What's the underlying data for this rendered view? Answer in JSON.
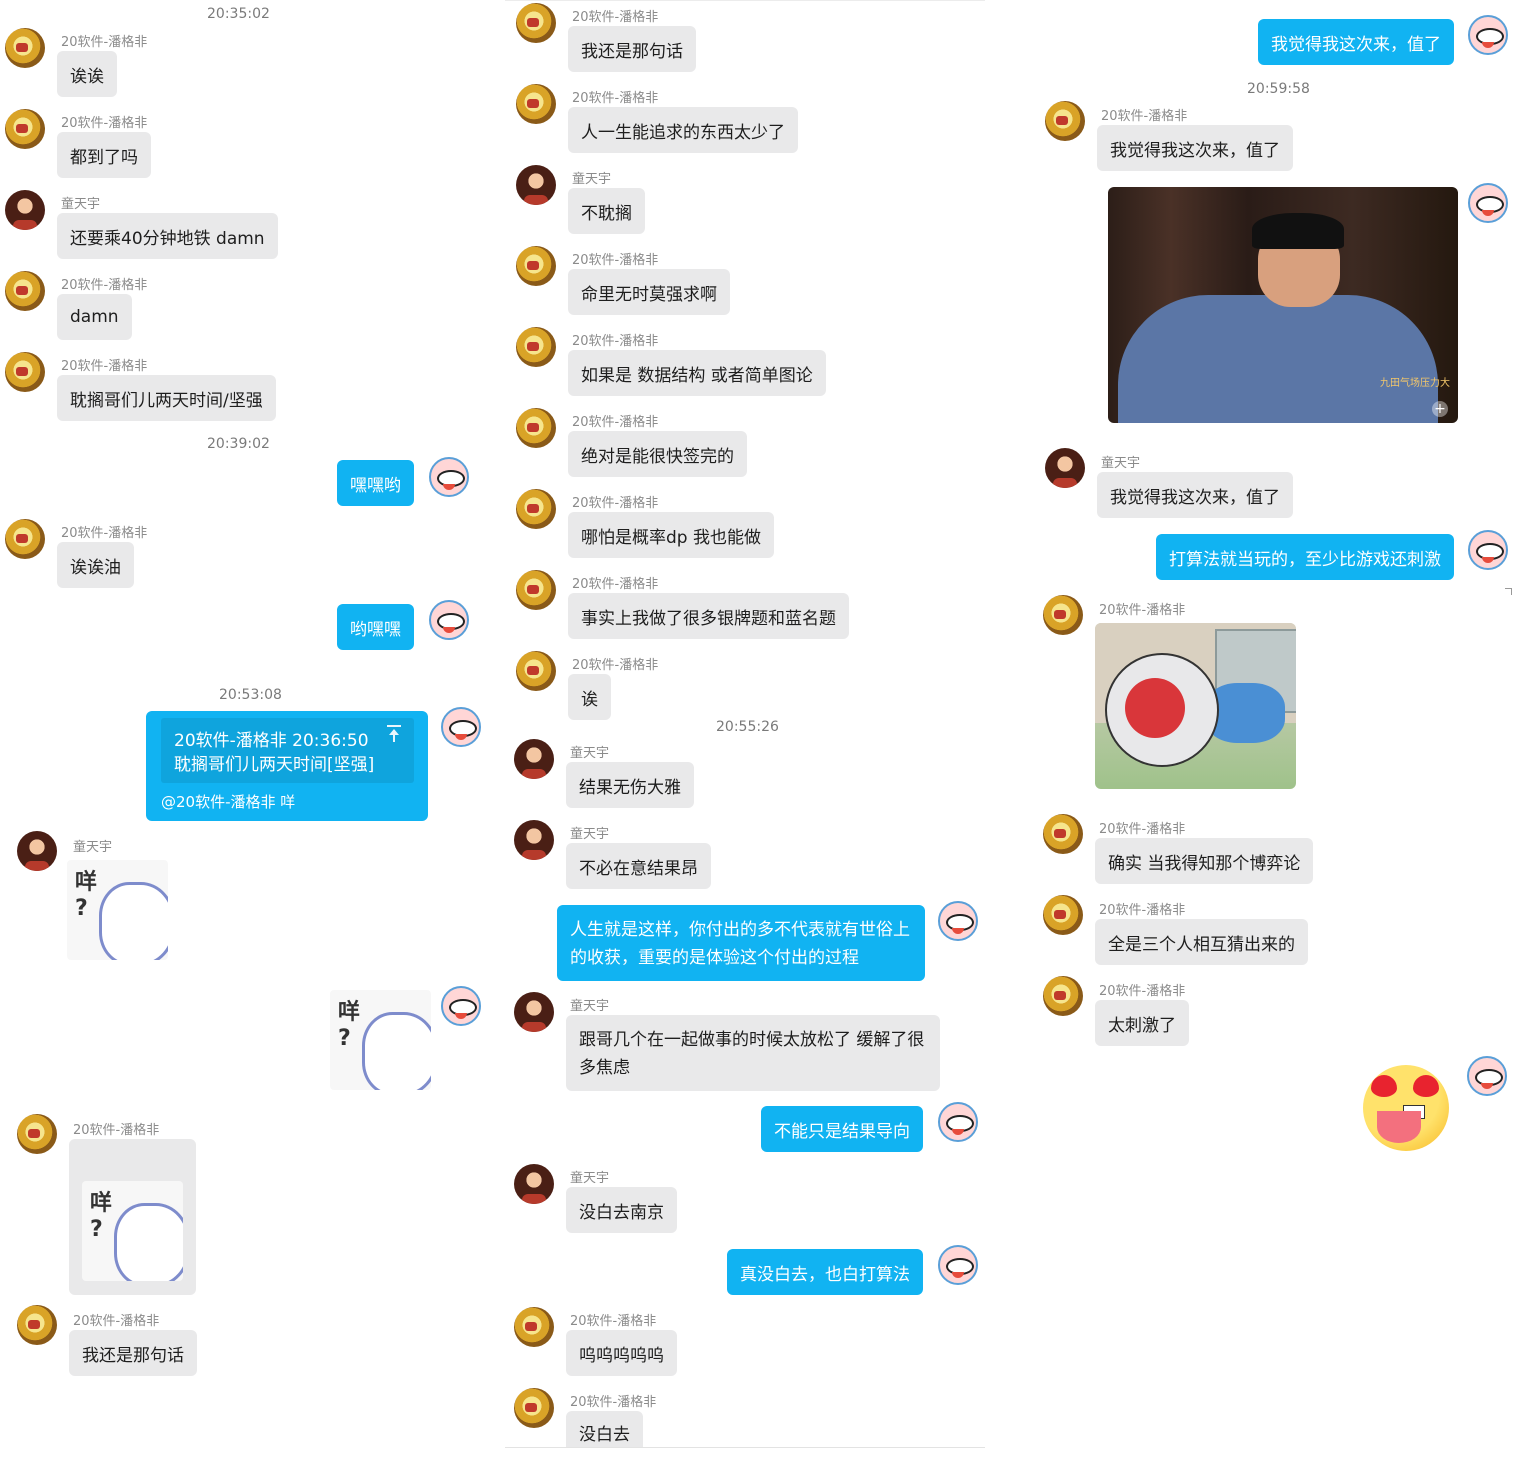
{
  "col1": {
    "ts1": "20:35:02",
    "m1": {
      "name": "20软件-潘格非",
      "text": "诶诶"
    },
    "m2": {
      "name": "20软件-潘格非",
      "text": "都到了吗"
    },
    "m3": {
      "name": "童天宇",
      "text": "还要乘40分钟地铁 damn"
    },
    "m4": {
      "name": "20软件-潘格非",
      "text": "damn"
    },
    "m5": {
      "name": "20软件-潘格非",
      "text": "耽搁哥们儿两天时间/坚强"
    },
    "ts2": "20:39:02",
    "m6": {
      "text": "嘿嘿哟"
    },
    "m7": {
      "name": "20软件-潘格非",
      "text": "诶诶油"
    },
    "m8": {
      "text": "哟嘿嘿"
    },
    "ts3": "20:53:08",
    "quote": {
      "head": "20软件-潘格非   20:36:50",
      "body": "耽搁哥们儿两天时间[坚强]",
      "line": "@20软件-潘格非 咩"
    },
    "m9": {
      "name": "童天宇",
      "sticker": "咩\n?"
    },
    "m10": {
      "sticker": "咩\n?"
    },
    "m11": {
      "name": "20软件-潘格非",
      "sticker": "咩\n?"
    },
    "m12": {
      "name": "20软件-潘格非",
      "text": "我还是那句话"
    }
  },
  "col2": {
    "m1": {
      "name": "20软件-潘格非",
      "text": "我还是那句话"
    },
    "m2": {
      "name": "20软件-潘格非",
      "text": "人一生能追求的东西太少了"
    },
    "m3": {
      "name": "童天宇",
      "text": "不耽搁"
    },
    "m4": {
      "name": "20软件-潘格非",
      "text": "命里无时莫强求啊"
    },
    "m5": {
      "name": "20软件-潘格非",
      "text": "如果是 数据结构 或者简单图论"
    },
    "m6": {
      "name": "20软件-潘格非",
      "text": "绝对是能很快签完的"
    },
    "m7": {
      "name": "20软件-潘格非",
      "text": "哪怕是概率dp 我也能做"
    },
    "m8": {
      "name": "20软件-潘格非",
      "text": "事实上我做了很多银牌题和蓝名题"
    },
    "m9": {
      "name": "20软件-潘格非",
      "text": "诶"
    },
    "ts1": "20:55:26",
    "m10": {
      "name": "童天宇",
      "text": "结果无伤大雅"
    },
    "m11": {
      "name": "童天宇",
      "text": "不必在意结果昂"
    },
    "m12": {
      "text": "人生就是这样，你付出的多不代表就有世俗上的收获，重要的是体验这个付出的过程"
    },
    "m13": {
      "name": "童天宇",
      "text": "跟哥几个在一起做事的时候太放松了 缓解了很多焦虑"
    },
    "m14": {
      "text": "不能只是结果导向"
    },
    "m15": {
      "name": "童天宇",
      "text": "没白去南京"
    },
    "m16": {
      "text": "真没白去，也白打算法"
    },
    "m17": {
      "name": "20软件-潘格非",
      "text": "呜呜呜呜呜"
    },
    "m18": {
      "name": "20软件-潘格非",
      "text": "没白去"
    }
  },
  "col3": {
    "m1": {
      "text": "我觉得我这次来，值了"
    },
    "ts1": "20:59:58",
    "m2": {
      "name": "20软件-潘格非",
      "text": "我觉得我这次来，值了"
    },
    "photo_tag": "九田气场压力大",
    "m3": {
      "name": "童天宇",
      "text": "我觉得我这次来，值了"
    },
    "m4": {
      "text": "打算法就当玩的，至少比游戏还刺激"
    },
    "m5": {
      "name": "20软件-潘格非"
    },
    "m6": {
      "name": "20软件-潘格非",
      "text": "确实 当我得知那个博弈论"
    },
    "m7": {
      "name": "20软件-潘格非",
      "text": "全是三个人相互猜出来的"
    },
    "m8": {
      "name": "20软件-潘格非",
      "text": "太刺激了"
    }
  },
  "colors": {
    "self_bubble": "#11b3f2",
    "other_bubble": "#e9e9ea",
    "name": "#8b8b8b"
  },
  "icons": [
    "avatar-panggefei",
    "avatar-tongtianyu",
    "avatar-self-penguin",
    "pin-top-icon",
    "image-expand-icon"
  ]
}
